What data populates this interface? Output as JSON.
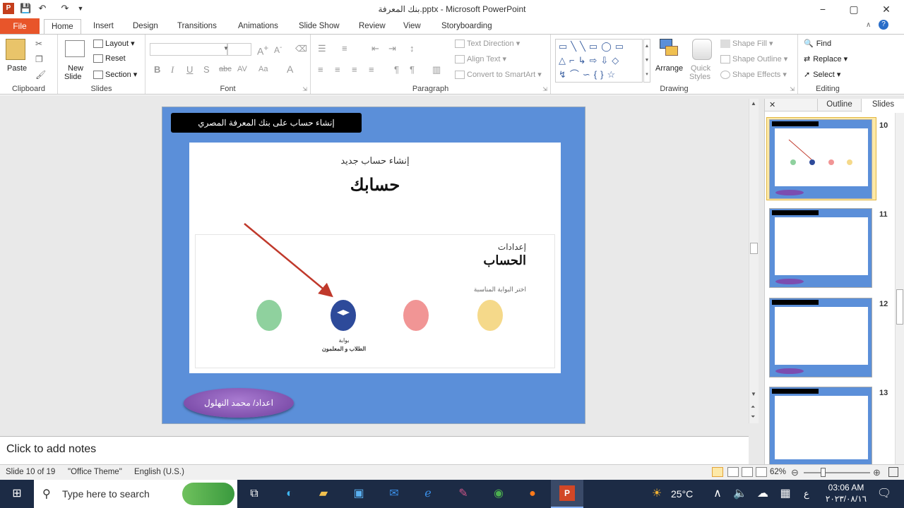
{
  "window": {
    "title": "بنك المعرفة.pptx - Microsoft PowerPoint",
    "minimize": "−",
    "restore": "▢",
    "close": "✕"
  },
  "tabs": [
    "File",
    "Home",
    "Insert",
    "Design",
    "Transitions",
    "Animations",
    "Slide Show",
    "Review",
    "View",
    "Storyboarding"
  ],
  "ribbon": {
    "clipboard": {
      "label": "Clipboard",
      "paste": "Paste"
    },
    "slides": {
      "label": "Slides",
      "new_slide": "New",
      "new_slide2": "Slide",
      "layout": "Layout",
      "reset": "Reset",
      "section": "Section"
    },
    "font": {
      "label": "Font"
    },
    "paragraph": {
      "label": "Paragraph",
      "text_direction": "Text Direction",
      "align_text": "Align Text",
      "convert_smartart": "Convert to SmartArt"
    },
    "drawing": {
      "label": "Drawing",
      "arrange": "Arrange",
      "quick_styles": "Quick",
      "quick_styles2": "Styles",
      "shape_fill": "Shape Fill",
      "shape_outline": "Shape Outline",
      "shape_effects": "Shape Effects"
    },
    "editing": {
      "label": "Editing",
      "find": "Find",
      "replace": "Replace",
      "select": "Select"
    }
  },
  "slide": {
    "title": "إنشاء حساب على بنك المعرفة المصري",
    "heading_small": "إنشاء حساب جديد",
    "heading_big": "حسابك",
    "settings_small": "إعدادات",
    "settings_big": "الحساب",
    "choose_portal": "اختر البوابة المناسبة",
    "portal_label_1": "بوابة",
    "portal_label_2": "الطلاب و المعلمون",
    "author": "اعداد/ محمد النهلول",
    "colors": {
      "green": "#8fd19e",
      "blue": "#2d4a9a",
      "red": "#f19595",
      "yellow": "#f5d98a",
      "arrow": "#c0392b"
    }
  },
  "panel": {
    "outline_tab": "Outline",
    "slides_tab": "Slides",
    "close": "✕",
    "thumbs": [
      "10",
      "11",
      "12",
      "13"
    ]
  },
  "notes": {
    "placeholder": "Click to add notes"
  },
  "status": {
    "slide_count": "Slide 10 of 19",
    "theme": "\"Office Theme\"",
    "language": "English (U.S.)",
    "zoom": "62%"
  },
  "taskbar": {
    "search_placeholder": "Type here to search",
    "temperature": "25°C",
    "input_lang": "ع",
    "time": "03:06 AM",
    "date": "٢٠٢٣/٠٨/١٦"
  }
}
